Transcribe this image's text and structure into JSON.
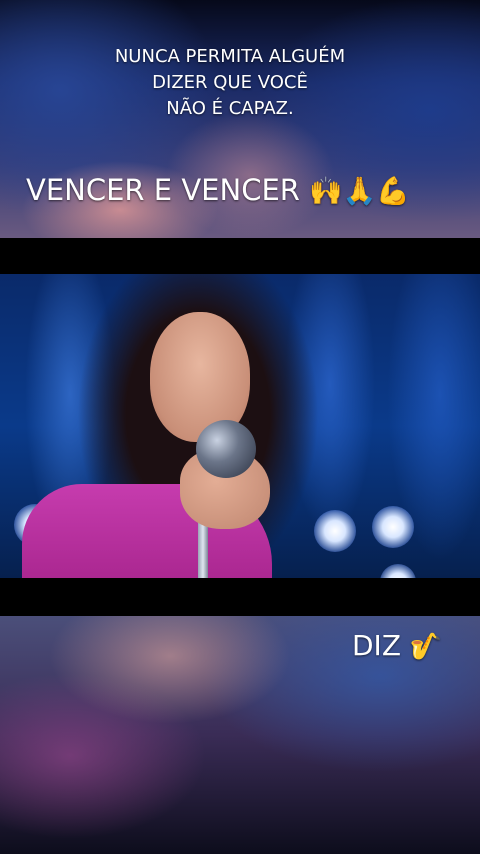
{
  "captions": {
    "top_lines": [
      "NUNCA PERMITA ALGUÉM",
      "DIZER QUE VOCÊ",
      "NÃO É CAPAZ."
    ],
    "main_text": "VENCER E VENCER",
    "main_emojis": "🙌🙏💪",
    "bottom_text": "DIZ",
    "bottom_emoji": "🎷"
  },
  "icons": {
    "main_emojis": [
      "raising-hands-icon",
      "folded-hands-icon",
      "flexed-biceps-icon"
    ],
    "bottom_emoji": "saxophone-icon"
  }
}
